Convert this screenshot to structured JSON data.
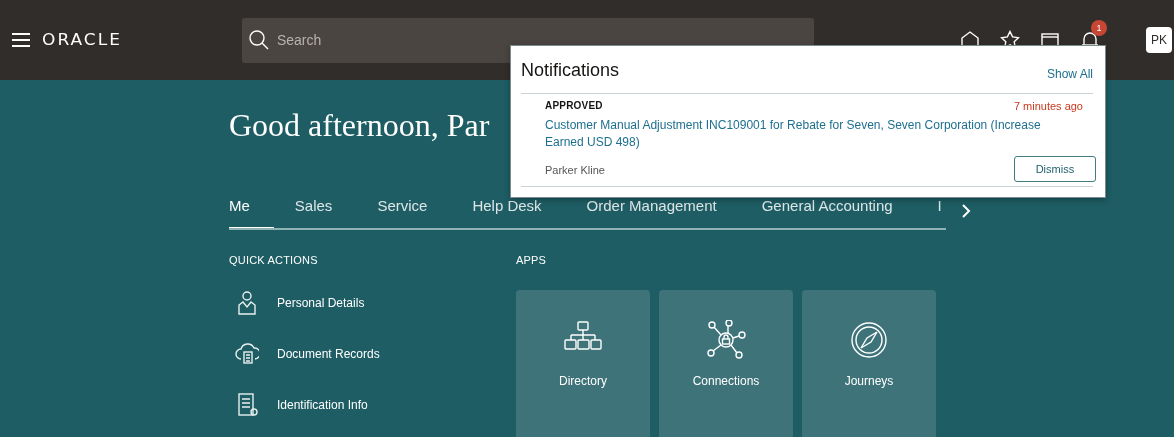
{
  "header": {
    "logo": "ORACLE",
    "search": {
      "placeholder": "Search"
    },
    "notification_count": "1",
    "avatar": "PK"
  },
  "notifications": {
    "title": "Notifications",
    "show_all": "Show All",
    "items": [
      {
        "status": "APPROVED",
        "time": "7 minutes ago",
        "message": "Customer Manual Adjustment INC109001 for Rebate for Seven, Seven Corporation (Increase Earned USD 498)",
        "author": "Parker Kline",
        "action": "Dismiss"
      }
    ]
  },
  "greeting": "Good afternoon, Par",
  "tabs": [
    {
      "label": "Me",
      "selected": true
    },
    {
      "label": "Sales",
      "selected": false
    },
    {
      "label": "Service",
      "selected": false
    },
    {
      "label": "Help Desk",
      "selected": false
    },
    {
      "label": "Order Management",
      "selected": false
    },
    {
      "label": "General Accounting",
      "selected": false
    },
    {
      "label": "I",
      "selected": false
    }
  ],
  "quick_actions": {
    "title": "QUICK ACTIONS",
    "items": [
      {
        "label": "Personal Details"
      },
      {
        "label": "Document Records"
      },
      {
        "label": "Identification Info"
      }
    ]
  },
  "apps": {
    "title": "APPS",
    "items": [
      {
        "label": "Directory"
      },
      {
        "label": "Connections"
      },
      {
        "label": "Journeys"
      }
    ]
  }
}
